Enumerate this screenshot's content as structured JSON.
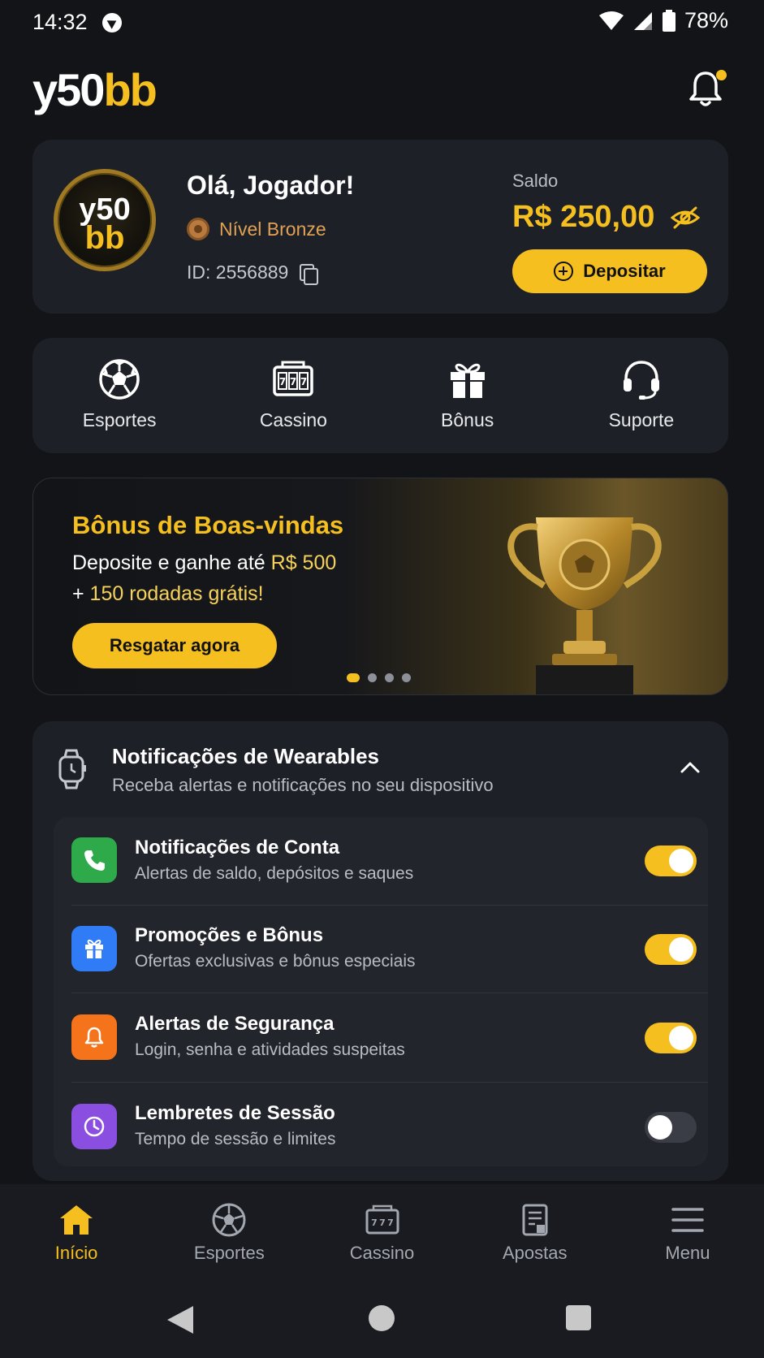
{
  "status_bar": {
    "time": "14:32",
    "battery": "78%"
  },
  "header": {
    "logo_white": "y50",
    "logo_yellow": "bb"
  },
  "profile": {
    "avatar_top": "y50",
    "avatar_bottom": "bb",
    "greeting": "Olá, Jogador!",
    "level": "Nível Bronze",
    "user_id": "ID: 2556889",
    "balance_label": "Saldo",
    "balance_value": "R$ 250,00",
    "deposit_label": "Depositar"
  },
  "quick_nav": [
    {
      "label": "Esportes",
      "icon": "soccer-ball-icon"
    },
    {
      "label": "Cassino",
      "icon": "slot-machine-icon"
    },
    {
      "label": "Bônus",
      "icon": "gift-icon"
    },
    {
      "label": "Suporte",
      "icon": "headset-icon"
    }
  ],
  "banner": {
    "title": "Bônus de Boas-vindas",
    "line1_prefix": "Deposite e ganhe até ",
    "line1_highlight": "R$ 500",
    "line2_prefix": "+ ",
    "line2_highlight": "150 rodadas grátis!",
    "button": "Resgatar agora",
    "active_slide": 1,
    "slide_count": 4
  },
  "wearables": {
    "title": "Notificações de Wearables",
    "subtitle": "Receba alertas e notificações no seu dispositivo",
    "items": [
      {
        "title": "Notificações de Conta",
        "subtitle": "Alertas de saldo, depósitos e saques",
        "icon": "phone-icon",
        "color": "#2eaa4a",
        "enabled": true
      },
      {
        "title": "Promoções e Bônus",
        "subtitle": "Ofertas exclusivas e bônus especiais",
        "icon": "gift-icon",
        "color": "#2f7cf6",
        "enabled": true
      },
      {
        "title": "Alertas de Segurança",
        "subtitle": "Login, senha e atividades suspeitas",
        "icon": "bell-icon",
        "color": "#f5731a",
        "enabled": true
      },
      {
        "title": "Lembretes de Sessão",
        "subtitle": "Tempo de sessão e limites",
        "icon": "clock-icon",
        "color": "#8a4fe0",
        "enabled": false
      }
    ]
  },
  "bottom_nav": [
    {
      "label": "Início",
      "icon": "home-icon",
      "active": true
    },
    {
      "label": "Esportes",
      "icon": "soccer-ball-icon",
      "active": false
    },
    {
      "label": "Cassino",
      "icon": "slot-machine-icon",
      "active": false
    },
    {
      "label": "Apostas",
      "icon": "bet-slip-icon",
      "active": false
    },
    {
      "label": "Menu",
      "icon": "hamburger-menu-icon",
      "active": false
    }
  ],
  "colors": {
    "accent": "#f5bf1f",
    "background": "#121418",
    "card": "#1d2027"
  }
}
